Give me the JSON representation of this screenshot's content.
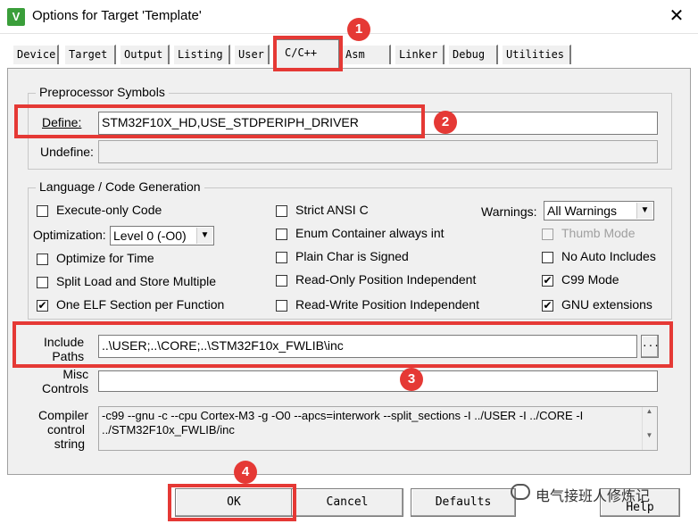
{
  "window": {
    "title": "Options for Target 'Template'",
    "close_glyph": "✕",
    "app_icon": "V"
  },
  "tabs": [
    "Device",
    "Target",
    "Output",
    "Listing",
    "User",
    "C/C++",
    "Asm",
    "Linker",
    "Debug",
    "Utilities"
  ],
  "preprocessor": {
    "group_title": "Preprocessor Symbols",
    "define_label": "Define:",
    "define_value": "STM32F10X_HD,USE_STDPERIPH_DRIVER",
    "undefine_label": "Undefine:",
    "undefine_value": ""
  },
  "language": {
    "group_title": "Language / Code Generation",
    "execute_only": "Execute-only Code",
    "optimization_label": "Optimization:",
    "optimization_value": "Level 0 (-O0)",
    "optimize_time": "Optimize for Time",
    "split_load": "Split Load and Store Multiple",
    "one_elf": "One ELF Section per Function",
    "strict_ansi": "Strict ANSI C",
    "enum_container": "Enum Container always int",
    "plain_char": "Plain Char is Signed",
    "ro_pi": "Read-Only Position Independent",
    "rw_pi": "Read-Write Position Independent",
    "warnings_label": "Warnings:",
    "warnings_value": "All Warnings",
    "thumb_mode": "Thumb Mode",
    "no_auto_includes": "No Auto Includes",
    "c99_mode": "C99 Mode",
    "gnu_ext": "GNU extensions",
    "checked_glyph": "✔"
  },
  "include": {
    "label_line1": "Include",
    "label_line2": "Paths",
    "value": "..\\USER;..\\CORE;..\\STM32F10x_FWLIB\\inc",
    "browse": "..."
  },
  "misc": {
    "label_line1": "Misc",
    "label_line2": "Controls",
    "value": ""
  },
  "compiler": {
    "label_line1": "Compiler",
    "label_line2": "control",
    "label_line3": "string",
    "line1": "-c99 --gnu -c --cpu Cortex-M3 -g -O0 --apcs=interwork --split_sections -I ../USER -I ../CORE -I",
    "line2": "../STM32F10x_FWLIB/inc"
  },
  "buttons": {
    "ok": "OK",
    "cancel": "Cancel",
    "defaults": "Defaults",
    "help": "Help"
  },
  "annotations": [
    "1",
    "2",
    "3",
    "4"
  ],
  "watermark": "电气接班人修炼记",
  "colors": {
    "highlight": "#e53935"
  }
}
